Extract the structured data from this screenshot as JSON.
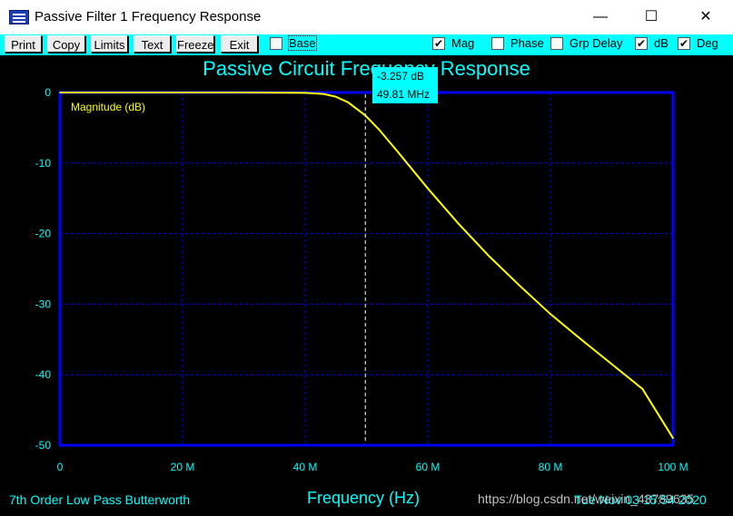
{
  "window": {
    "title": "Passive Filter 1 Frequency Response",
    "minimize_icon": "—",
    "maximize_icon": "☐",
    "close_icon": "✕"
  },
  "toolbar": {
    "buttons": [
      "Print",
      "Copy",
      "Limits",
      "Text",
      "Freeze",
      "Exit"
    ],
    "checkboxes": [
      {
        "label": "Base",
        "checked": false
      },
      {
        "label": "Mag",
        "checked": true
      },
      {
        "label": "Phase",
        "checked": false
      },
      {
        "label": "Grp Delay",
        "checked": false
      },
      {
        "label": "dB",
        "checked": true
      },
      {
        "label": "Deg",
        "checked": true
      }
    ]
  },
  "plot": {
    "title": "Passive Circuit Frequency Response",
    "trace_label": "Magnitude (dB)",
    "xlabel": "Frequency (Hz)",
    "footer_left": "7th Order Low Pass Butterworth",
    "footer_date": "Tue Nov 03 15:54 2020",
    "watermark": "https://blog.csdn.net/weixin_43789635",
    "cursor": {
      "value": "-3.257 dB",
      "freq": "49.81 MHz"
    }
  },
  "colors": {
    "background": "#000000",
    "axis": "#0000ff",
    "grid": "#0000ff",
    "trace": "#ffff00",
    "text": "#00ffff",
    "cursor_line": "#ffffff"
  },
  "chart_data": {
    "type": "line",
    "title": "Passive Circuit Frequency Response",
    "xlabel": "Frequency (Hz)",
    "ylabel": "",
    "xlim": [
      0,
      100000000
    ],
    "ylim": [
      -50,
      0
    ],
    "x_ticks": [
      "0",
      "20 M",
      "40 M",
      "60 M",
      "80 M",
      "100 M"
    ],
    "y_ticks": [
      "0",
      "-10",
      "-20",
      "-30",
      "-40",
      "-50"
    ],
    "grid": true,
    "series": [
      {
        "name": "Magnitude (dB)",
        "color": "#ffff00",
        "x": [
          0,
          10000000,
          20000000,
          30000000,
          40000000,
          43000000,
          45000000,
          47000000,
          49810000,
          52000000,
          55000000,
          60000000,
          65000000,
          70000000,
          75000000,
          80000000,
          85000000,
          90000000,
          95000000,
          100000000
        ],
        "y": [
          0,
          0,
          0,
          0,
          -0.05,
          -0.2,
          -0.6,
          -1.4,
          -3.257,
          -5.2,
          -8.3,
          -13.6,
          -18.6,
          -23.2,
          -27.4,
          -31.4,
          -35.0,
          -38.5,
          -42.0,
          -49.0
        ]
      }
    ],
    "cursor": {
      "x": 49810000,
      "y": -3.257
    }
  }
}
